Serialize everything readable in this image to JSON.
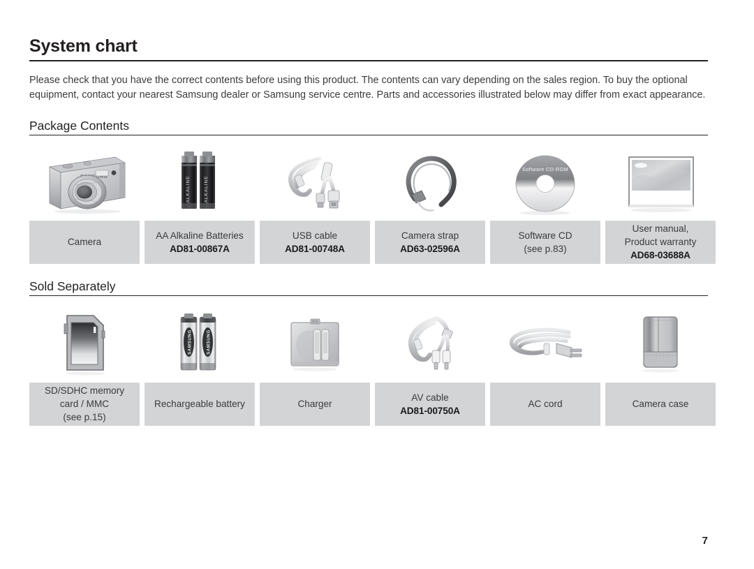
{
  "document": {
    "title": "System chart",
    "intro": "Please check that you have the correct contents before using this product. The contents can vary depending on the sales region. To buy the optional equipment, contact your nearest Samsung dealer or Samsung service centre. Parts and accessories illustrated below may differ from exact appearance.",
    "page_number": "7"
  },
  "sections": [
    {
      "heading": "Package Contents",
      "items": [
        {
          "icon": "camera-icon",
          "name": "Camera",
          "detail": "",
          "code": ""
        },
        {
          "icon": "aa-batteries-icon",
          "name": "AA Alkaline Batteries",
          "detail": "",
          "code": "AD81-00867A"
        },
        {
          "icon": "usb-cable-icon",
          "name": "USB cable",
          "detail": "",
          "code": "AD81-00748A"
        },
        {
          "icon": "camera-strap-icon",
          "name": "Camera strap",
          "detail": "",
          "code": "AD63-02596A"
        },
        {
          "icon": "software-cd-icon",
          "name": "Software CD",
          "detail": "(see p.83)",
          "code": ""
        },
        {
          "icon": "user-manual-icon",
          "name": "User manual,",
          "detail": "Product warranty",
          "code": "AD68-03688A"
        }
      ]
    },
    {
      "heading": "Sold Separately",
      "items": [
        {
          "icon": "sd-card-icon",
          "name": "SD/SDHC memory",
          "detail": "card / MMC",
          "detail2": "(see p.15)",
          "code": ""
        },
        {
          "icon": "rechargeable-battery-icon",
          "name": "Rechargeable battery",
          "detail": "",
          "code": ""
        },
        {
          "icon": "charger-icon",
          "name": "Charger",
          "detail": "",
          "code": ""
        },
        {
          "icon": "av-cable-icon",
          "name": "AV cable",
          "detail": "",
          "code": "AD81-00750A"
        },
        {
          "icon": "ac-cord-icon",
          "name": "AC cord",
          "detail": "",
          "code": ""
        },
        {
          "icon": "camera-case-icon",
          "name": "Camera case",
          "detail": "",
          "code": ""
        }
      ]
    }
  ],
  "artwork_text": {
    "camera_brand": "SAMSUNG",
    "cd_label": "Software CD-ROM",
    "battery_brand": "SAMSUNG"
  },
  "colors": {
    "label_background": "#d3d4d6",
    "text": "#231f20",
    "body_text": "#3b3b3b",
    "rule": "#231f20"
  }
}
